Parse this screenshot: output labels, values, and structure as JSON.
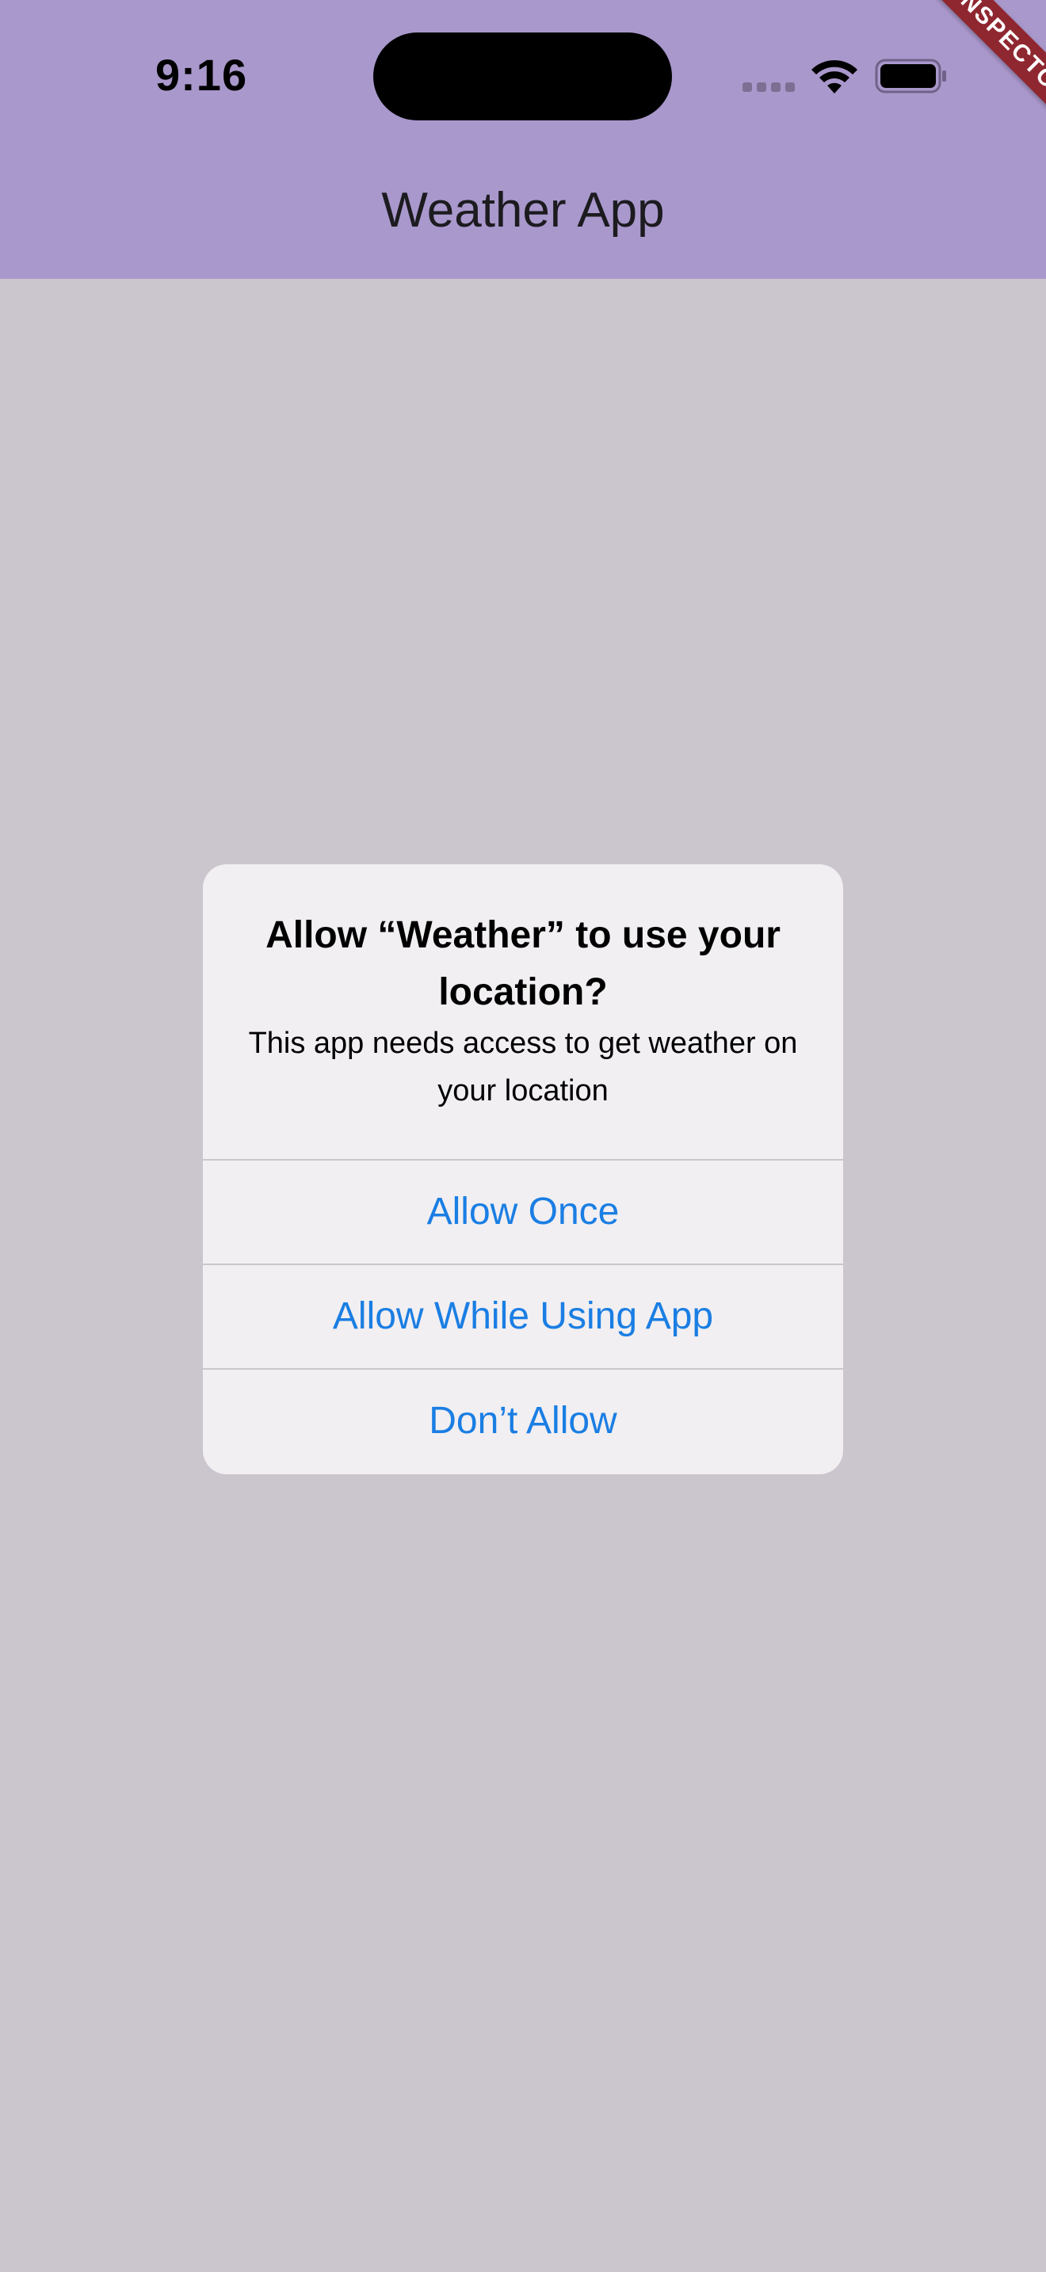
{
  "status_bar": {
    "time": "9:16"
  },
  "banner": {
    "label": "INSPECTOR"
  },
  "app_bar": {
    "title": "Weather App"
  },
  "dialog": {
    "title": "Allow “Weather” to use your location?",
    "message": "This app needs access to get weather on your location",
    "actions": [
      {
        "label": "Allow Once"
      },
      {
        "label": "Allow While Using App"
      },
      {
        "label": "Don’t Allow"
      }
    ]
  },
  "colors": {
    "app_bar": "#a998cc",
    "background": "#cbc6cd",
    "dialog": "#f1eff2",
    "action_text": "#1a7ee3",
    "banner": "#8f2730"
  },
  "icons": [
    "signal-dots-icon",
    "wifi-icon",
    "battery-icon"
  ]
}
